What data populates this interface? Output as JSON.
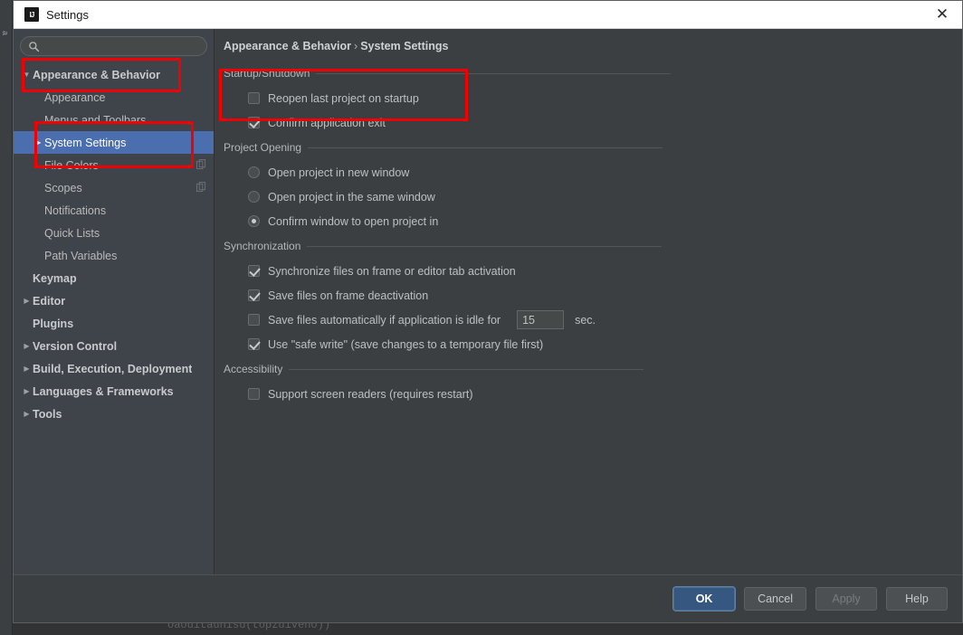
{
  "window": {
    "title": "Settings",
    "logo_icon": "intellij-idea-logo",
    "close_icon": "close-icon"
  },
  "search": {
    "value": "",
    "placeholder": "",
    "icon": "search-icon"
  },
  "sidebar": {
    "items": [
      {
        "label": "Appearance & Behavior",
        "level": 0,
        "arrow": "expanded",
        "bold": true,
        "selected": false,
        "badge": ""
      },
      {
        "label": "Appearance",
        "level": 1,
        "arrow": "none",
        "bold": false,
        "selected": false,
        "badge": ""
      },
      {
        "label": "Menus and Toolbars",
        "level": 1,
        "arrow": "none",
        "bold": false,
        "selected": false,
        "badge": ""
      },
      {
        "label": "System Settings",
        "level": 1,
        "arrow": "collapsed",
        "bold": false,
        "selected": true,
        "badge": ""
      },
      {
        "label": "File Colors",
        "level": 1,
        "arrow": "none",
        "bold": false,
        "selected": false,
        "badge": "copy-icon"
      },
      {
        "label": "Scopes",
        "level": 1,
        "arrow": "none",
        "bold": false,
        "selected": false,
        "badge": "copy-icon"
      },
      {
        "label": "Notifications",
        "level": 1,
        "arrow": "none",
        "bold": false,
        "selected": false,
        "badge": ""
      },
      {
        "label": "Quick Lists",
        "level": 1,
        "arrow": "none",
        "bold": false,
        "selected": false,
        "badge": ""
      },
      {
        "label": "Path Variables",
        "level": 1,
        "arrow": "none",
        "bold": false,
        "selected": false,
        "badge": ""
      },
      {
        "label": "Keymap",
        "level": 0,
        "arrow": "none",
        "bold": true,
        "selected": false,
        "badge": ""
      },
      {
        "label": "Editor",
        "level": 0,
        "arrow": "collapsed",
        "bold": true,
        "selected": false,
        "badge": ""
      },
      {
        "label": "Plugins",
        "level": 0,
        "arrow": "none",
        "bold": true,
        "selected": false,
        "badge": ""
      },
      {
        "label": "Version Control",
        "level": 0,
        "arrow": "collapsed",
        "bold": true,
        "selected": false,
        "badge": ""
      },
      {
        "label": "Build, Execution, Deployment",
        "level": 0,
        "arrow": "collapsed",
        "bold": true,
        "selected": false,
        "badge": ""
      },
      {
        "label": "Languages & Frameworks",
        "level": 0,
        "arrow": "collapsed",
        "bold": true,
        "selected": false,
        "badge": ""
      },
      {
        "label": "Tools",
        "level": 0,
        "arrow": "collapsed",
        "bold": true,
        "selected": false,
        "badge": ""
      }
    ]
  },
  "main": {
    "breadcrumb": {
      "parent": "Appearance & Behavior",
      "separator": "›",
      "current": "System Settings"
    },
    "groups": [
      {
        "title": "Startup/Shutdown",
        "options": [
          {
            "type": "checkbox",
            "label": "Reopen last project on startup",
            "checked": false
          },
          {
            "type": "checkbox",
            "label": "Confirm application exit",
            "checked": true
          }
        ]
      },
      {
        "title": "Project Opening",
        "options": [
          {
            "type": "radio",
            "label": "Open project in new window",
            "checked": false
          },
          {
            "type": "radio",
            "label": "Open project in the same window",
            "checked": false
          },
          {
            "type": "radio",
            "label": "Confirm window to open project in",
            "checked": true
          }
        ]
      },
      {
        "title": "Synchronization",
        "options": [
          {
            "type": "checkbox",
            "label": "Synchronize files on frame or editor tab activation",
            "checked": true
          },
          {
            "type": "checkbox",
            "label": "Save files on frame deactivation",
            "checked": true
          },
          {
            "type": "checkbox",
            "label": "Save files automatically if application is idle for",
            "checked": false,
            "field_value": "15",
            "field_unit": "sec."
          },
          {
            "type": "checkbox",
            "label": "Use \"safe write\" (save changes to a temporary file first)",
            "checked": true
          }
        ]
      },
      {
        "title": "Accessibility",
        "options": [
          {
            "type": "checkbox",
            "label": "Support screen readers (requires restart)",
            "checked": false
          }
        ]
      }
    ]
  },
  "footer": {
    "ok": "OK",
    "cancel": "Cancel",
    "apply": "Apply",
    "help": "Help"
  },
  "backdrop": {
    "code_text": "oaouitaunisu(topzuiveno))",
    "left_glyph": "a"
  },
  "colors": {
    "accent_selection": "#4b6eaf",
    "primary_button": "#365880",
    "annotation_red": "#f00000",
    "panel_bg": "#3c3f41",
    "sidebar_bg": "#3f434a"
  }
}
